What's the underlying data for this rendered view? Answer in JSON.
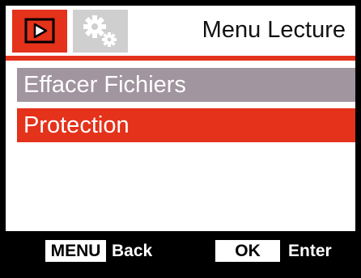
{
  "header": {
    "title": "Menu Lecture",
    "tabs": [
      {
        "icon": "playback-icon",
        "active": true
      },
      {
        "icon": "settings-gears-icon",
        "active": false
      }
    ]
  },
  "menu": {
    "items": [
      {
        "label": "Effacer Fichiers",
        "state": "normal"
      },
      {
        "label": "Protection",
        "state": "selected"
      }
    ]
  },
  "footer": {
    "menu_key": "MENU",
    "menu_action": "Back",
    "ok_key": "OK",
    "ok_action": "Enter"
  },
  "colors": {
    "accent": "#e4321b",
    "item_normal": "#a1959f",
    "tab_inactive": "#cfcfcf",
    "footer_bg": "#000000"
  }
}
